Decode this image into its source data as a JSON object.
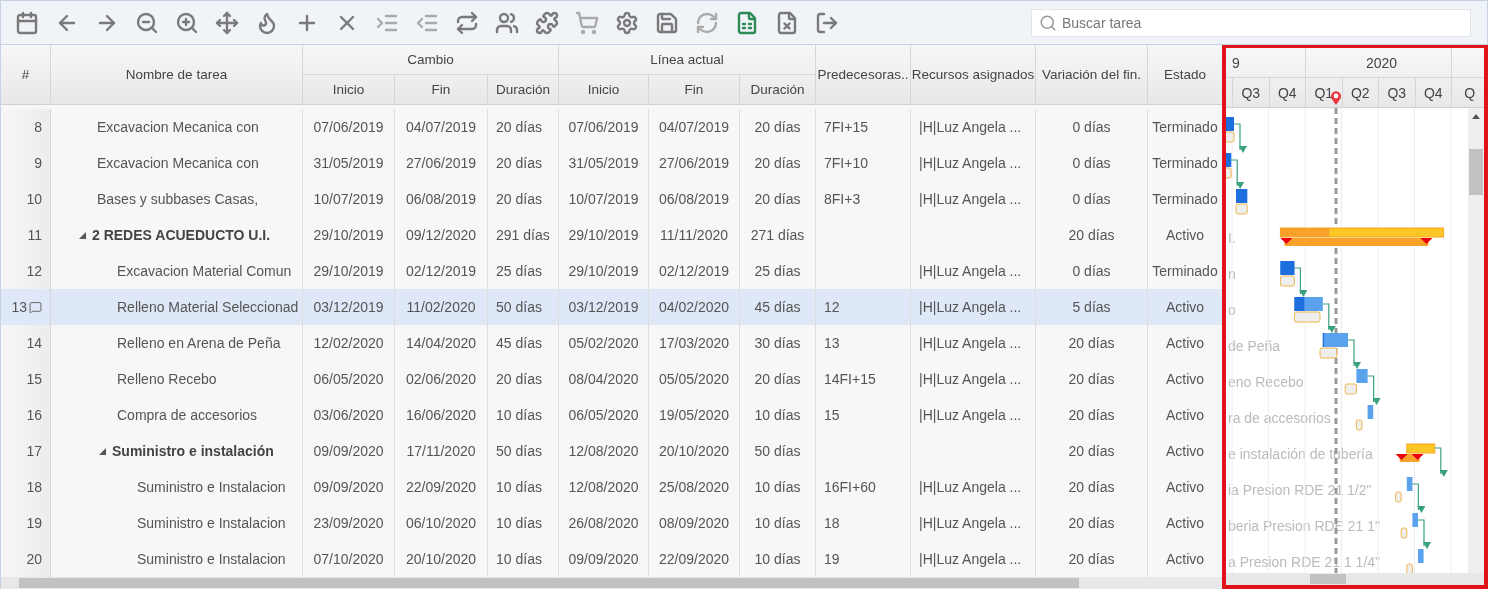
{
  "toolbar": {
    "search": {
      "placeholder": "Buscar tarea"
    }
  },
  "columns": {
    "number": "#",
    "name": "Nombre de tarea",
    "groups": [
      {
        "title": "Cambio",
        "columns": [
          "Inicio",
          "Fin",
          "Duración"
        ]
      },
      {
        "title": "Línea actual",
        "columns": [
          "Inicio",
          "Fin",
          "Duración"
        ]
      }
    ],
    "others": [
      "Predecesoras..",
      "Recursos asignados",
      "Variación del fin.",
      "Estado"
    ]
  },
  "timescale": {
    "years": [
      "9",
      "2020"
    ],
    "quarters": [
      "Q3",
      "Q4",
      "Q1",
      "Q2",
      "Q3",
      "Q4",
      "Q"
    ]
  },
  "tasks": [
    {
      "kind": "task",
      "number": "8",
      "name": "Excavacion Mecanica con",
      "change": [
        "07/06/2019",
        "04/07/2019",
        "20 días"
      ],
      "current": [
        "07/06/2019",
        "04/07/2019",
        "20 días"
      ],
      "predecessors": "7FI+15",
      "resources": "|H|Luz Angela ...",
      "variance": "0 días",
      "status": "Terminado",
      "level": 1,
      "selected": false,
      "has_note": false
    },
    {
      "kind": "task",
      "number": "9",
      "name": "Excavacion Mecanica con",
      "change": [
        "31/05/2019",
        "27/06/2019",
        "20 días"
      ],
      "current": [
        "31/05/2019",
        "27/06/2019",
        "20 días"
      ],
      "predecessors": "7FI+10",
      "resources": "|H|Luz Angela ...",
      "variance": "0 días",
      "status": "Terminado",
      "level": 1,
      "selected": false,
      "has_note": false
    },
    {
      "kind": "task",
      "number": "10",
      "name": "Bases y subbases Casas,",
      "change": [
        "10/07/2019",
        "06/08/2019",
        "20 días"
      ],
      "current": [
        "10/07/2019",
        "06/08/2019",
        "20 días"
      ],
      "predecessors": "8FI+3",
      "resources": "|H|Luz Angela ...",
      "variance": "0 días",
      "status": "Terminado",
      "level": 1,
      "selected": false,
      "has_note": false
    },
    {
      "kind": "summary",
      "number": "11",
      "name": "2 REDES ACUEDUCTO U.I.",
      "change": [
        "29/10/2019",
        "09/12/2020",
        "291 días"
      ],
      "current": [
        "29/10/2019",
        "11/11/2020",
        "271 días"
      ],
      "variance": "20 días",
      "status": "Activo",
      "level": 0.3,
      "selected": false,
      "has_note": false,
      "expanded": true,
      "gantt_label": "I.",
      "children": [
        {
          "kind": "task",
          "number": "12",
          "name": "Excavacion Material Comun",
          "change": [
            "29/10/2019",
            "02/12/2019",
            "25 días"
          ],
          "current": [
            "29/10/2019",
            "02/12/2019",
            "25 días"
          ],
          "resources": "|H|Luz Angela ...",
          "variance": "0 días",
          "status": "Terminado",
          "level": 1,
          "selected": false,
          "has_note": false,
          "gantt_label": "n"
        },
        {
          "kind": "task",
          "number": "13",
          "name": "Relleno Material Seleccionad",
          "change": [
            "03/12/2019",
            "11/02/2020",
            "50 días"
          ],
          "current": [
            "03/12/2019",
            "04/02/2020",
            "45 días"
          ],
          "predecessors": "12",
          "resources": "|H|Luz Angela ...",
          "variance": "5 días",
          "status": "Activo",
          "level": 0.35,
          "selected": true,
          "has_note": true,
          "gantt_label": "o"
        },
        {
          "kind": "task",
          "number": "14",
          "name": "Relleno en Arena de Peña",
          "change": [
            "12/02/2020",
            "14/04/2020",
            "45 días"
          ],
          "current": [
            "05/02/2020",
            "17/03/2020",
            "30 días"
          ],
          "predecessors": "13",
          "resources": "|H|Luz Angela ...",
          "variance": "20 días",
          "status": "Activo",
          "level": 0.05,
          "selected": false,
          "has_note": false,
          "gantt_label": "de Peña"
        },
        {
          "kind": "task",
          "number": "15",
          "name": "Relleno Recebo",
          "change": [
            "06/05/2020",
            "02/06/2020",
            "20 días"
          ],
          "current": [
            "08/04/2020",
            "05/05/2020",
            "20 días"
          ],
          "predecessors": "14FI+15",
          "resources": "|H|Luz Angela ...",
          "variance": "20 días",
          "status": "Activo",
          "level": 0,
          "selected": false,
          "has_note": false,
          "gantt_label": "eno Recebo"
        },
        {
          "kind": "task",
          "number": "16",
          "name": "Compra de accesorios",
          "change": [
            "03/06/2020",
            "16/06/2020",
            "10 días"
          ],
          "current": [
            "06/05/2020",
            "19/05/2020",
            "10 días"
          ],
          "predecessors": "15",
          "resources": "|H|Luz Angela ...",
          "variance": "20 días",
          "status": "Activo",
          "level": 0,
          "selected": false,
          "has_note": false,
          "gantt_label": "ra de accesorios"
        },
        {
          "kind": "summary",
          "number": "17",
          "name": "Suministro e instalación",
          "change": [
            "09/09/2020",
            "17/11/2020",
            "50 días"
          ],
          "current": [
            "12/08/2020",
            "20/10/2020",
            "50 días"
          ],
          "variance": "20 días",
          "status": "Activo",
          "level": 0,
          "selected": false,
          "has_note": false,
          "expanded": true,
          "gantt_label": "e instalación de tubería",
          "children": [
            {
              "kind": "task",
              "number": "18",
              "name": "Suministro e Instalacion",
              "change": [
                "09/09/2020",
                "22/09/2020",
                "10 días"
              ],
              "current": [
                "12/08/2020",
                "25/08/2020",
                "10 días"
              ],
              "predecessors": "16FI+60",
              "resources": "|H|Luz Angela ...",
              "variance": "20 días",
              "status": "Activo",
              "level": 0,
              "selected": false,
              "has_note": false,
              "gantt_label": "ia Presion RDE 21 1/2\""
            },
            {
              "kind": "task",
              "number": "19",
              "name": "Suministro e Instalacion",
              "change": [
                "23/09/2020",
                "06/10/2020",
                "10 días"
              ],
              "current": [
                "26/08/2020",
                "08/09/2020",
                "10 días"
              ],
              "predecessors": "18",
              "resources": "|H|Luz Angela ...",
              "variance": "20 días",
              "status": "Activo",
              "level": 0,
              "selected": false,
              "has_note": false,
              "gantt_label": "beria Presion RDE 21 1\""
            },
            {
              "kind": "task",
              "number": "20",
              "name": "Suministro e Instalacion",
              "change": [
                "07/10/2020",
                "20/10/2020",
                "10 días"
              ],
              "current": [
                "09/09/2020",
                "22/09/2020",
                "10 días"
              ],
              "predecessors": "19",
              "resources": "|H|Luz Angela ...",
              "variance": "20 días",
              "status": "Activo",
              "level": 0,
              "selected": false,
              "has_note": false,
              "gantt_label": "a Presion RDE 21 1 1/4\""
            }
          ]
        }
      ]
    }
  ]
}
